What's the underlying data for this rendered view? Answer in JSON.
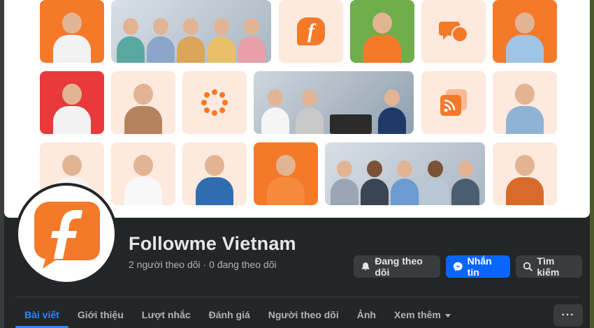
{
  "page": {
    "name": "Followme Vietnam",
    "stats": "2 người theo dõi · 0 đang theo dõi"
  },
  "actions": {
    "following_label": "Đang theo dõi",
    "message_label": "Nhắn tin",
    "search_label": "Tìm kiếm"
  },
  "tabs": [
    {
      "label": "Bài viết",
      "active": true
    },
    {
      "label": "Giới thiệu"
    },
    {
      "label": "Lượt nhắc"
    },
    {
      "label": "Đánh giá"
    },
    {
      "label": "Người theo dõi"
    },
    {
      "label": "Ảnh"
    },
    {
      "label": "Xem thêm"
    }
  ],
  "more_menu_label": "···",
  "colors": {
    "brand_orange": "#f47a2a",
    "accent_blue": "#0866ff",
    "active_tab_blue": "#2d88ff",
    "background": "#242526"
  },
  "icons": {
    "following": "bell-icon",
    "message": "messenger-icon",
    "search": "search-icon"
  }
}
